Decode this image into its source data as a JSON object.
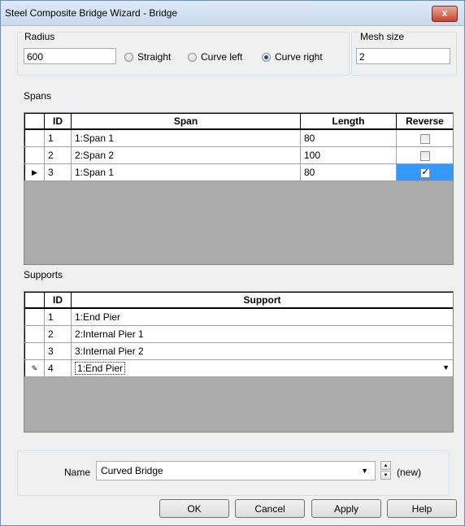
{
  "window": {
    "title": "Steel Composite Bridge Wizard - Bridge",
    "close_label": "x"
  },
  "radius": {
    "label": "Radius",
    "value": "600"
  },
  "alignment": {
    "options": [
      "Straight",
      "Curve left",
      "Curve right"
    ],
    "selected": "Curve right"
  },
  "mesh": {
    "label": "Mesh size",
    "value": "2"
  },
  "spans": {
    "label": "Spans",
    "columns": [
      "ID",
      "Span",
      "Length",
      "Reverse"
    ],
    "rows": [
      {
        "id": "1",
        "span": "1:Span 1",
        "length": "80",
        "reverse": false
      },
      {
        "id": "2",
        "span": "2:Span 2",
        "length": "100",
        "reverse": false
      },
      {
        "id": "3",
        "span": "1:Span 1",
        "length": "80",
        "reverse": true,
        "current": true
      }
    ]
  },
  "supports": {
    "label": "Supports",
    "columns": [
      "ID",
      "Support"
    ],
    "rows": [
      {
        "id": "1",
        "support": "1:End Pier"
      },
      {
        "id": "2",
        "support": "2:Internal Pier 1"
      },
      {
        "id": "3",
        "support": "3:Internal Pier 2"
      },
      {
        "id": "4",
        "support": "1:End Pier",
        "editing": true
      }
    ]
  },
  "name_field": {
    "label": "Name",
    "value": "Curved Bridge",
    "status": "(new)"
  },
  "buttons": {
    "ok": "OK",
    "cancel": "Cancel",
    "apply": "Apply",
    "help": "Help"
  },
  "colors": {
    "selection": "#3399ff",
    "title_bar": "#c9dbef",
    "close": "#c8442e"
  }
}
